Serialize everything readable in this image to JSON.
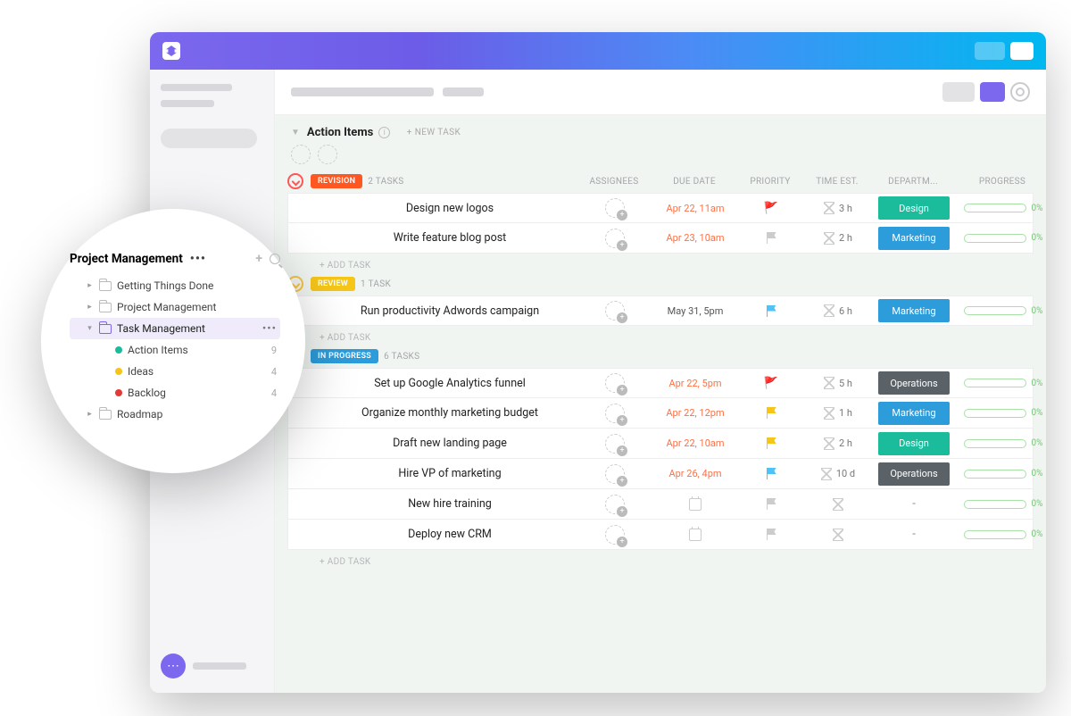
{
  "header": {
    "list_title": "Action Items",
    "new_task_label": "+ NEW TASK",
    "add_task_label": "+ ADD TASK"
  },
  "columns": {
    "assignees": "ASSIGNEES",
    "due": "DUE DATE",
    "priority": "PRIORITY",
    "time": "TIME EST.",
    "dept": "DEPARTM...",
    "progress": "PROGRESS"
  },
  "groups": [
    {
      "name": "REVISION",
      "color": "#FF5722",
      "count_label": "2 TASKS",
      "tasks": [
        {
          "name": "Design new logos",
          "due": "Apr 22, 11am",
          "due_color": "#FF7043",
          "flag": "🚩",
          "flag_color": "#E53935",
          "est": "3 h",
          "dept": "Design",
          "dept_color": "#1ABC9C",
          "progress": "0%"
        },
        {
          "name": "Write feature blog post",
          "due": "Apr 23, 10am",
          "due_color": "#FF7043",
          "flag": "",
          "flag_color": "#CCC",
          "est": "2 h",
          "dept": "Marketing",
          "dept_color": "#2D9CDB",
          "progress": "0%"
        }
      ]
    },
    {
      "name": "REVIEW",
      "color": "#F5C518",
      "count_label": "1 TASK",
      "tasks": [
        {
          "name": "Run productivity Adwords campaign",
          "due": "May 31, 5pm",
          "due_color": "#555",
          "flag": "",
          "flag_color": "#4FC3F7",
          "est": "6 h",
          "dept": "Marketing",
          "dept_color": "#2D9CDB",
          "progress": "0%"
        }
      ]
    },
    {
      "name": "IN PROGRESS",
      "color": "#2D9CDB",
      "count_label": "6 TASKS",
      "tasks": [
        {
          "name": "Set up Google Analytics funnel",
          "due": "Apr 22, 5pm",
          "due_color": "#FF7043",
          "flag": "🚩",
          "flag_color": "#E53935",
          "est": "5 h",
          "dept": "Operations",
          "dept_color": "#5A6268",
          "progress": "0%"
        },
        {
          "name": "Organize monthly marketing budget",
          "due": "Apr 22, 12pm",
          "due_color": "#FF7043",
          "flag": "",
          "flag_color": "#F5C518",
          "est": "1 h",
          "dept": "Marketing",
          "dept_color": "#2D9CDB",
          "progress": "0%"
        },
        {
          "name": "Draft new landing page",
          "due": "Apr 22, 10am",
          "due_color": "#FF7043",
          "flag": "",
          "flag_color": "#F5C518",
          "est": "2 h",
          "dept": "Design",
          "dept_color": "#1ABC9C",
          "progress": "0%"
        },
        {
          "name": "Hire VP of marketing",
          "due": "Apr 26, 4pm",
          "due_color": "#FF7043",
          "flag": "",
          "flag_color": "#4FC3F7",
          "est": "10 d",
          "dept": "Operations",
          "dept_color": "#5A6268",
          "progress": "0%"
        },
        {
          "name": "New hire training",
          "due": "",
          "due_color": "",
          "flag": "",
          "flag_color": "",
          "est": "",
          "dept": "-",
          "dept_color": "",
          "progress": "0%"
        },
        {
          "name": "Deploy new CRM",
          "due": "",
          "due_color": "",
          "flag": "",
          "flag_color": "",
          "est": "",
          "dept": "-",
          "dept_color": "",
          "progress": "0%"
        }
      ]
    }
  ],
  "sidebar_bubble": {
    "title": "Project Management",
    "rows": [
      {
        "type": "folder",
        "label": "Getting Things Done",
        "indent": 1,
        "expanded": false
      },
      {
        "type": "folder",
        "label": "Project Management",
        "indent": 1,
        "expanded": false
      },
      {
        "type": "folder",
        "label": "Task Management",
        "indent": 1,
        "expanded": true,
        "selected": true
      },
      {
        "type": "list",
        "label": "Action Items",
        "indent": 2,
        "dot": "#1ABC9C",
        "count": "9"
      },
      {
        "type": "list",
        "label": "Ideas",
        "indent": 2,
        "dot": "#F5C518",
        "count": "4"
      },
      {
        "type": "list",
        "label": "Backlog",
        "indent": 2,
        "dot": "#E53935",
        "count": "4"
      },
      {
        "type": "folder",
        "label": "Roadmap",
        "indent": 1,
        "expanded": false
      }
    ]
  }
}
